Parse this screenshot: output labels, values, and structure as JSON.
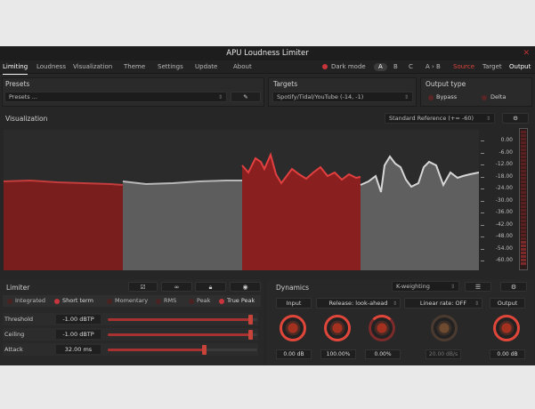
{
  "window": {
    "title": "APU Loudness Limiter",
    "close": "✕"
  },
  "menu": {
    "items": [
      "Limiting",
      "Loudness",
      "Visualization",
      "Theme",
      "Settings",
      "Update",
      "About"
    ],
    "dark_mode": "Dark mode",
    "ab": [
      "A",
      "B",
      "C",
      "A › B"
    ],
    "views": [
      "Source",
      "Target",
      "Output"
    ]
  },
  "presets": {
    "title": "Presets",
    "value": "Presets ...",
    "edit_icon": "pencil-icon"
  },
  "targets": {
    "title": "Targets",
    "value": "Spotify/Tidal/YouTube (-14, -1)"
  },
  "output_type": {
    "title": "Output type",
    "options": [
      "Bypass",
      "Delta"
    ]
  },
  "visualization": {
    "title": "Visualization",
    "reference": "Standard Reference (+= -60)",
    "scale": [
      "0.00",
      "-6.00",
      "-12.00",
      "-18.00",
      "-24.00",
      "-30.00",
      "-36.00",
      "-42.00",
      "-48.00",
      "-54.00",
      "-60.00"
    ]
  },
  "limiter": {
    "title": "Limiter",
    "modes": [
      "Integrated",
      "Short term",
      "Momentary",
      "RMS",
      "Peak",
      "True Peak"
    ],
    "rows": [
      {
        "label": "Threshold",
        "value": "-1.00 dBTP",
        "level": 0.95
      },
      {
        "label": "Ceiling",
        "value": "-1.00 dBTP",
        "level": 0.95
      },
      {
        "label": "Attack",
        "value": "32.00 ms",
        "level": 0.64
      }
    ]
  },
  "dynamics": {
    "title": "Dynamics",
    "weighting": "K-weighting",
    "columns": [
      {
        "label": "Input",
        "value": "0.00 dB"
      },
      {
        "label": "Release: look-ahead",
        "value": "100.00%"
      },
      {
        "label": "",
        "value": "0.00%"
      },
      {
        "label": "Linear rate: OFF",
        "value": "20.00 dB/s"
      },
      {
        "label": "Output",
        "value": "0.00 dB"
      }
    ]
  },
  "colors": {
    "accent": "#c8343b",
    "background": "#262626"
  }
}
